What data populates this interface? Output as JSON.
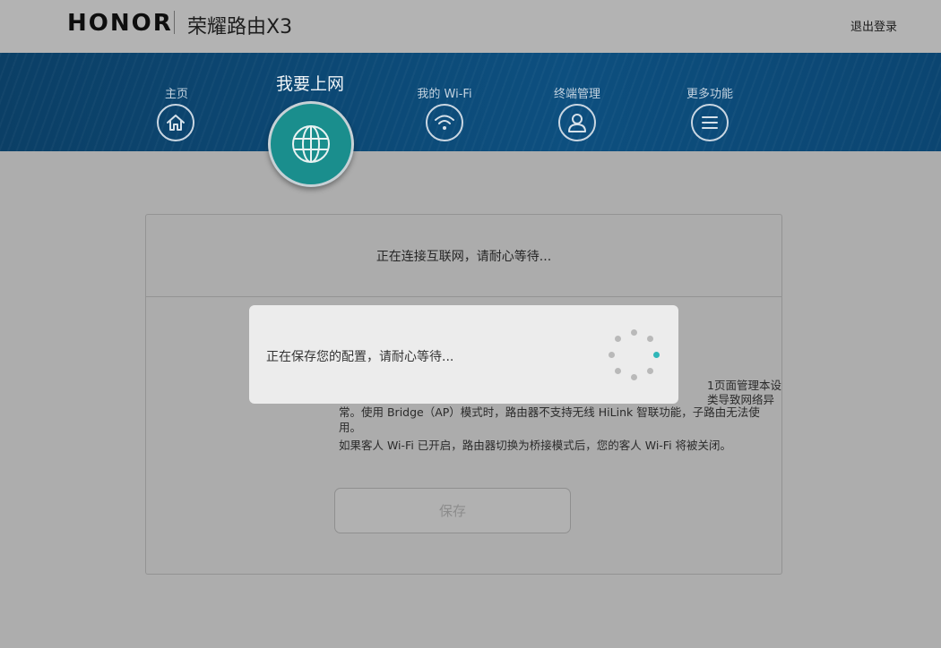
{
  "header": {
    "brand": "HONOR",
    "product": "荣耀路由X3",
    "logout_label": "退出登录"
  },
  "nav": {
    "items": [
      {
        "label": "主页",
        "icon": "home-icon"
      },
      {
        "label": "我要上网",
        "icon": "globe-icon",
        "active": true
      },
      {
        "label": "我的 Wi-Fi",
        "icon": "wifi-icon"
      },
      {
        "label": "终端管理",
        "icon": "user-icon"
      },
      {
        "label": "更多功能",
        "icon": "menu-icon"
      }
    ]
  },
  "panel": {
    "status": "正在连接互联网，请耐心等待...",
    "visible_text": {
      "line1_tail": "1页面管理本设",
      "line2_tail": "类导致网络异",
      "line3": "常。使用 Bridge（AP）模式时，路由器不支持无线 HiLink 智联功能，子路由无法使",
      "line4": "用。",
      "line5": "如果客人 Wi-Fi 已开启，路由器切换为桥接模式后，您的客人 Wi-Fi 将被关闭。"
    },
    "save_label": "保存"
  },
  "modal": {
    "message": "正在保存您的配置，请耐心等待...",
    "spinner_active_color": "#2fb6b8"
  },
  "colors": {
    "nav_band": "#0d4f7f",
    "active_circle": "#1a8e8d"
  }
}
